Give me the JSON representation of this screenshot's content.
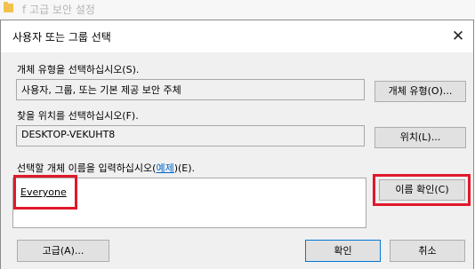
{
  "background_window": {
    "title": "f 고급 보안 설정"
  },
  "dialog": {
    "title": "사용자 또는 그룹 선택",
    "object_type": {
      "label": "개체 유형을 선택하십시오(S).",
      "value": "사용자, 그룹, 또는 기본 제공 보안 주체",
      "button": "개체 유형(O)..."
    },
    "location": {
      "label": "찾을 위치를 선택하십시오(F).",
      "value": "DESKTOP-VEKUHT8",
      "button": "위치(L)..."
    },
    "names": {
      "label_prefix": "선택할 개체 이름을 입력하십시오(",
      "label_link": "예제",
      "label_suffix": ")(E).",
      "entered_value": "Everyone",
      "check_button": "이름 확인(C)"
    },
    "footer": {
      "advanced_button": "고급(A)...",
      "ok_button": "확인",
      "cancel_button": "취소"
    }
  },
  "annotation_color": "#e0192b"
}
